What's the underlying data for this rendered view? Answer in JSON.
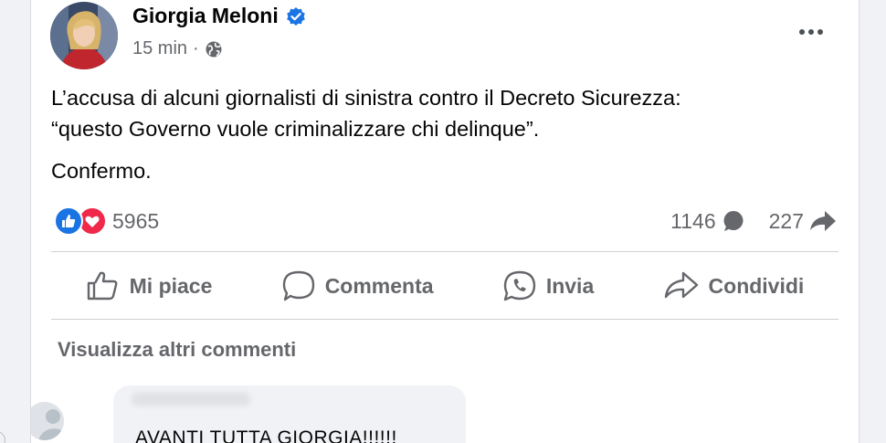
{
  "post": {
    "author": "Giorgia Meloni",
    "verified": true,
    "time": "15 min",
    "separator": "·",
    "privacy_icon": "globe-icon",
    "text_line1": "L’accusa di alcuni giornalisti di sinistra contro il Decreto Sicurezza:",
    "text_line2": "“questo Governo vuole criminalizzare chi delinque”.",
    "text_line3": "Confermo."
  },
  "stats": {
    "reactions": "5965",
    "comments": "1146",
    "shares": "227"
  },
  "actions": {
    "like": "Mi piace",
    "comment": "Commenta",
    "send": "Invia",
    "share": "Condividi"
  },
  "comments_section": {
    "view_more": "Visualizza altri commenti",
    "first_comment_text": "AVANTI TUTTA GIORGIA!!!!!!"
  },
  "colors": {
    "accent": "#1b74e4",
    "love": "#f0284a",
    "muted_text": "#65676b",
    "background": "#f0f2f5"
  }
}
